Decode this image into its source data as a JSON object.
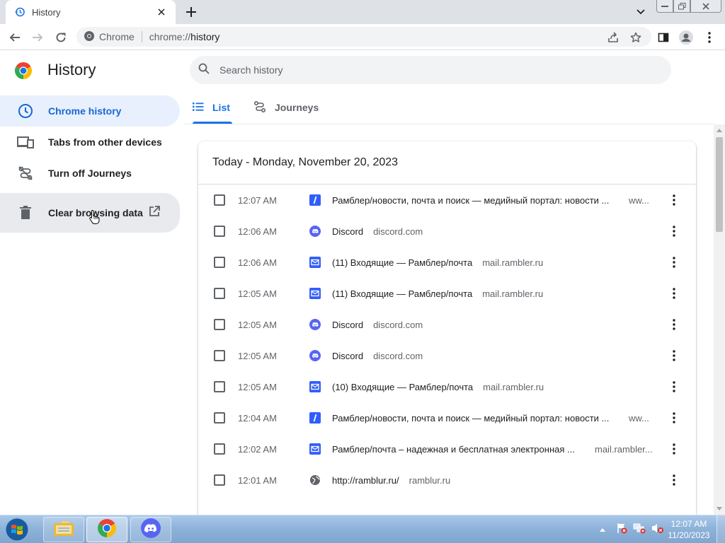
{
  "browser": {
    "tab_title": "History",
    "omnibox_site": "Chrome",
    "url_scheme": "chrome://",
    "url_path": "history"
  },
  "page": {
    "title": "History",
    "search_placeholder": "Search history"
  },
  "sidebar": {
    "items": [
      {
        "label": "Chrome history",
        "icon": "clock-icon"
      },
      {
        "label": "Tabs from other devices",
        "icon": "devices-icon"
      },
      {
        "label": "Turn off Journeys",
        "icon": "journeys-off-icon"
      },
      {
        "label": "Clear browsing data",
        "icon": "trash-icon"
      }
    ]
  },
  "tabs": {
    "list": "List",
    "journeys": "Journeys"
  },
  "history": {
    "date_header": "Today - Monday, November 20, 2023",
    "rows": [
      {
        "time": "12:07 AM",
        "favicon": "rambler-icon",
        "title": "Рамблер/новости, почта и поиск — медийный портал: новости ...",
        "domain": "ww..."
      },
      {
        "time": "12:06 AM",
        "favicon": "discord-icon",
        "title": "Discord",
        "domain": "discord.com"
      },
      {
        "time": "12:06 AM",
        "favicon": "mail-icon",
        "title": "(11) Входящие — Рамблер/почта",
        "domain": "mail.rambler.ru"
      },
      {
        "time": "12:05 AM",
        "favicon": "mail-icon",
        "title": "(11) Входящие — Рамблер/почта",
        "domain": "mail.rambler.ru"
      },
      {
        "time": "12:05 AM",
        "favicon": "discord-icon",
        "title": "Discord",
        "domain": "discord.com"
      },
      {
        "time": "12:05 AM",
        "favicon": "discord-icon",
        "title": "Discord",
        "domain": "discord.com"
      },
      {
        "time": "12:05 AM",
        "favicon": "mail-icon",
        "title": "(10) Входящие — Рамблер/почта",
        "domain": "mail.rambler.ru"
      },
      {
        "time": "12:04 AM",
        "favicon": "rambler-icon",
        "title": "Рамблер/новости, почта и поиск — медийный портал: новости ...",
        "domain": "ww..."
      },
      {
        "time": "12:02 AM",
        "favicon": "mail-icon",
        "title": "Рамблер/почта – надежная и бесплатная электронная ...",
        "domain": "mail.rambler..."
      },
      {
        "time": "12:01 AM",
        "favicon": "globe-icon",
        "title": "http://ramblur.ru/",
        "domain": "ramblur.ru"
      }
    ]
  },
  "taskbar": {
    "time": "12:07 AM",
    "date": "11/20/2023"
  },
  "colors": {
    "accent": "#1a73e8",
    "active_nav_bg": "#e8f0fe",
    "rambler_blue": "#315efb",
    "discord_blurple": "#5865f2"
  }
}
